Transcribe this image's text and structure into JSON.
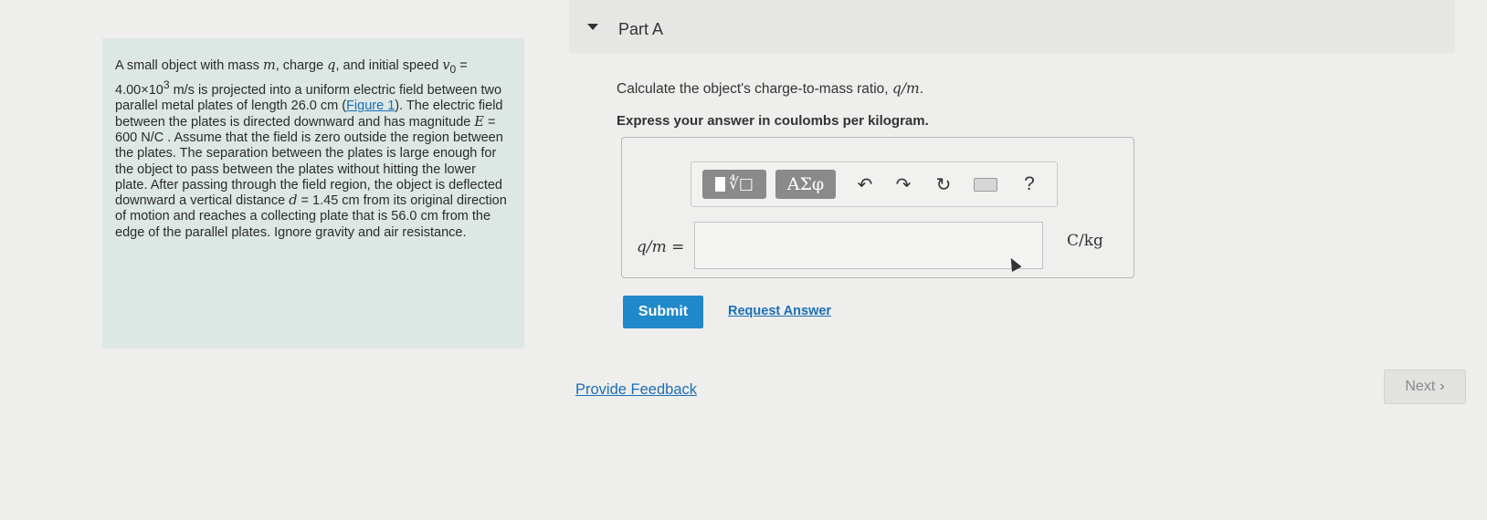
{
  "problem": {
    "p1": "A small object with mass ",
    "m": "m",
    "p2": ", charge ",
    "q": "q",
    "p3": ", and initial speed ",
    "v0": "v",
    "v0sub": "0",
    "p4": " = 4.00×10",
    "exp": "3",
    "p5": " m/s is projected into a uniform electric field between two parallel metal plates of length 26.0 cm (",
    "figure_link": "Figure 1",
    "p6": "). The electric field between the plates is directed downward and has magnitude ",
    "E": "E",
    "p7": " = 600 N/C . Assume that the field is zero outside the region between the plates. The separation between the plates is large enough for the object to pass between the plates without hitting the lower plate. After passing through the field region, the object is deflected downward a vertical distance ",
    "d": "d",
    "p8": " = 1.45 cm from its original direction of motion and reaches a collecting plate that is 56.0 cm from the edge of the parallel plates. Ignore gravity and air resistance."
  },
  "part": {
    "title": "Part A"
  },
  "question": {
    "text": "Calculate the object's charge-to-mass ratio, ",
    "ratio": "q/m",
    "end": "."
  },
  "instruction": "Express your answer in coulombs per kilogram.",
  "toolbar": {
    "root": "∜□",
    "symbols": "ΑΣφ",
    "undo": "↶",
    "redo": "↷",
    "reset": "↻",
    "help": "?"
  },
  "answer": {
    "label": "q/m =",
    "value": "",
    "unit": "C/kg"
  },
  "actions": {
    "submit": "Submit",
    "request_answer": "Request Answer",
    "feedback": "Provide Feedback",
    "next": "Next",
    "next_chevron": "›"
  },
  "colors": {
    "accent": "#1f89c9",
    "link": "#1b6fb5",
    "problem_bg": "#dde7e3"
  }
}
